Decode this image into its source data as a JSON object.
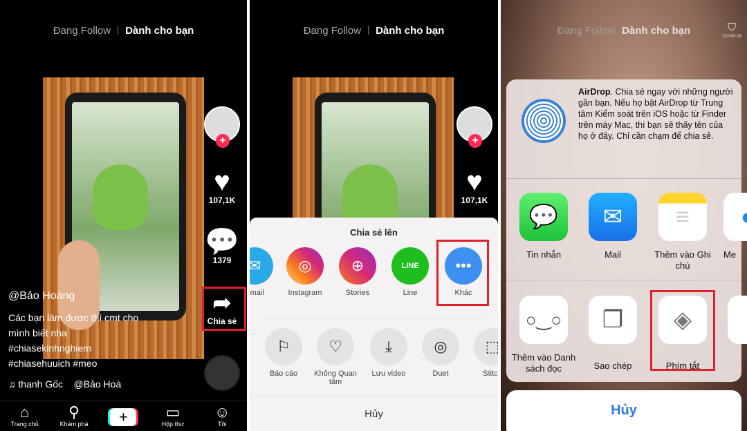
{
  "tabs": {
    "following": "Đang Follow",
    "for_you": "Dành cho bạn"
  },
  "panel1": {
    "likes": "107,1K",
    "comments": "1379",
    "share_label": "Chia sẻ",
    "username": "@Bảo Hoàng",
    "caption_lines": [
      "Các bạn làm được thì cmt cho",
      "mình biết nha",
      "#chiasekinhnghiem",
      "#chiasehuuich #meo"
    ],
    "music": "thanh Gốc    @Bảo Hoà",
    "nav": [
      {
        "label": "Trang chủ",
        "icon": "home-icon"
      },
      {
        "label": "Khám phá",
        "icon": "search-icon"
      },
      {
        "label": "+",
        "icon": "add-icon"
      },
      {
        "label": "Hộp thư",
        "icon": "inbox-icon"
      },
      {
        "label": "Tôi",
        "icon": "profile-icon"
      }
    ]
  },
  "panel2": {
    "likes": "107,1K",
    "sheet_title": "Chia sẻ lên",
    "share_targets": [
      {
        "label": "Email",
        "color": "#2aa8e8"
      },
      {
        "label": "Instagram",
        "color": "#d62976"
      },
      {
        "label": "Stories",
        "color": "#a13cc4"
      },
      {
        "label": "Line",
        "color": "#1fbe1f"
      },
      {
        "label": "Khác",
        "color": "#3d8ff0"
      }
    ],
    "actions": [
      {
        "label": "Báo cáo",
        "icon": "flag-icon"
      },
      {
        "label": "Không Quan tâm",
        "icon": "broken-heart-icon"
      },
      {
        "label": "Lưu video",
        "icon": "download-icon"
      },
      {
        "label": "Duet",
        "icon": "duet-icon"
      },
      {
        "label": "Stitch",
        "icon": "stitch-icon"
      }
    ],
    "cancel": "Hủy"
  },
  "panel3": {
    "covid_label": "COVID-19",
    "airdrop_title": "AirDrop",
    "airdrop_text": ". Chia sẻ ngay với những người gần bạn. Nếu họ bật AirDrop từ Trung tâm Kiểm soát trên iOS hoặc từ Finder trên máy Mac, thì bạn sẽ thấy tên của họ ở đây. Chỉ cần chạm để chia sẻ.",
    "apps": [
      {
        "label": "Tin nhắn",
        "icon": "messages-icon"
      },
      {
        "label": "Mail",
        "icon": "mail-icon"
      },
      {
        "label": "Thêm vào Ghi chú",
        "icon": "notes-icon"
      },
      {
        "label": "Me",
        "icon": "messenger-icon"
      }
    ],
    "actions": [
      {
        "label": "Thêm vào Danh sách đọc",
        "icon": "glasses-icon"
      },
      {
        "label": "Sao chép",
        "icon": "copy-icon"
      },
      {
        "label": "Phím tắt",
        "icon": "shortcuts-icon"
      }
    ],
    "cancel": "Hủy"
  },
  "colors": {
    "highlight": "#e0202a",
    "tiktok_red": "#fe2c55",
    "ios_blue": "#2b7be0"
  }
}
